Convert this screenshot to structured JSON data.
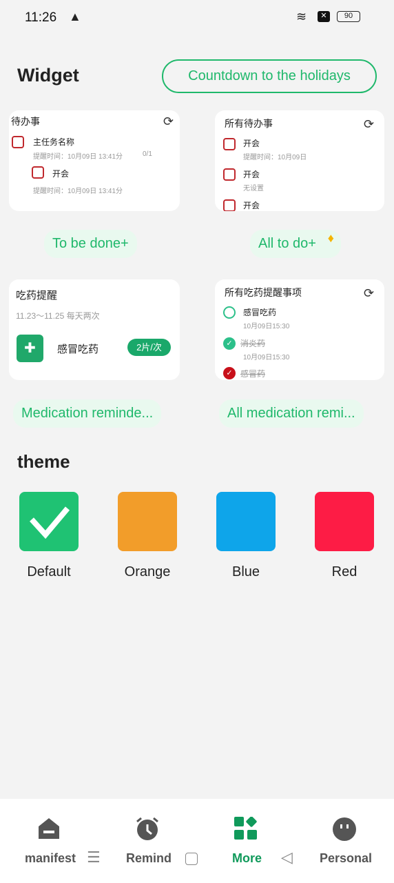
{
  "status": {
    "time": "11:26",
    "battery": "90",
    "icons": [
      "warning-icon",
      "wifi-icon",
      "sim-x-icon",
      "battery-icon"
    ]
  },
  "header": {
    "title": "Widget",
    "countdown_button": "Countdown to the holidays"
  },
  "widgets": {
    "todo": {
      "title": "待办事",
      "items": [
        {
          "name": "主任务名称",
          "sub": "提醒时间：10月09日 13:41分",
          "progress": "0/1"
        },
        {
          "name": "开会",
          "sub": "提醒时间：10月09日 13:41分"
        }
      ],
      "button": "To be done+"
    },
    "all_todo": {
      "title": "所有待办事",
      "items": [
        {
          "name": "开会",
          "sub": "提醒时间：10月09日"
        },
        {
          "name": "开会",
          "sub": "无设置"
        },
        {
          "name": "开会",
          "sub": ""
        }
      ],
      "button": "All to do+"
    },
    "medication": {
      "title": "吃药提醒",
      "range": "11.23～11.25 每天两次",
      "drug": "感冒吃药",
      "dose": "2片/次",
      "button": "Medication reminde..."
    },
    "all_medication": {
      "title": "所有吃药提醒事项",
      "items": [
        {
          "name": "感冒吃药",
          "sub": "10月09日15:30",
          "state": "pending"
        },
        {
          "name": "消炎药",
          "sub": "10月09日15:30",
          "state": "done"
        },
        {
          "name": "感冒药",
          "sub": "",
          "state": "done-red"
        }
      ],
      "button": "All medication remi..."
    }
  },
  "theme": {
    "title": "theme",
    "options": [
      {
        "label": "Default",
        "color": "#1fc273",
        "selected": true
      },
      {
        "label": "Orange",
        "color": "#f29d2a"
      },
      {
        "label": "Blue",
        "color": "#0ea5ea"
      },
      {
        "label": "Red",
        "color": "#fd1c45"
      }
    ]
  },
  "nav": {
    "items": [
      {
        "label": "manifest",
        "icon": "home-icon"
      },
      {
        "label": "Remind",
        "icon": "alarm-icon"
      },
      {
        "label": "More",
        "icon": "grid-icon",
        "active": true
      },
      {
        "label": "Personal",
        "icon": "face-icon"
      }
    ],
    "accent": "#109a5b"
  }
}
